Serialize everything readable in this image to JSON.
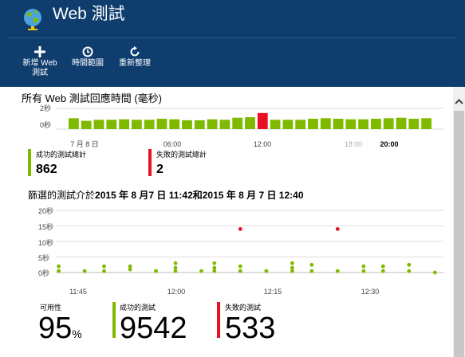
{
  "header": {
    "title": "Web 測試",
    "commands": [
      {
        "label_line1": "新增 Web",
        "label_line2": "測試"
      },
      {
        "label": "時間範圍"
      },
      {
        "label": "重新整理"
      }
    ]
  },
  "response_section": {
    "title": "所有 Web 測試回應時間 (毫秒)",
    "y_ticks": [
      "2秒",
      "0秒"
    ],
    "x_ticks": [
      {
        "label": "7 月 8 日",
        "style": "normal"
      },
      {
        "label": "06:00",
        "style": "normal"
      },
      {
        "label": "12:00",
        "style": "normal"
      },
      {
        "label": "18:00",
        "style": "dim"
      },
      {
        "label": "20:00",
        "style": "strong"
      }
    ]
  },
  "summary_stats": {
    "success_label": "成功的測試總計",
    "success_value": "862",
    "fail_label": "失敗的測試總計",
    "fail_value": "2"
  },
  "filter": {
    "prefix": "篩選的測試介於",
    "range": "2015 年 8 月7 日 11:42和2015 年 8 月 7 日 12:40"
  },
  "scatter_section": {
    "y_ticks": [
      "20秒",
      "15秒",
      "10秒",
      "5秒",
      "0秒"
    ],
    "x_ticks": [
      "11:45",
      "12:00",
      "12:15",
      "12:30"
    ]
  },
  "bottom_stats": {
    "availability_label": "可用性",
    "availability_value": "95",
    "availability_unit": "%",
    "success_label": "成功的測試",
    "success_value": "9542",
    "fail_label": "失敗的測試",
    "fail_value": "533"
  },
  "colors": {
    "header_bg": "#0e3d6e",
    "success": "#7fba00",
    "failure": "#e81123"
  },
  "chart_data": [
    {
      "type": "bar",
      "y_range_seconds": [
        0,
        2
      ],
      "series": [
        {
          "values": [
            1.05,
            0.8,
            0.9,
            0.9,
            0.95,
            0.9,
            0.9,
            1.0,
            0.95,
            0.85,
            0.85,
            0.95,
            0.9,
            1.1,
            1.15,
            1.55,
            0.9,
            0.9,
            0.9,
            1.0,
            1.05,
            1.0,
            0.95,
            0.95,
            1.0,
            1.05,
            1.1,
            1.0,
            1.05
          ],
          "status": [
            "ok",
            "ok",
            "ok",
            "ok",
            "ok",
            "ok",
            "ok",
            "ok",
            "ok",
            "ok",
            "ok",
            "ok",
            "ok",
            "ok",
            "ok",
            "fail",
            "ok",
            "ok",
            "ok",
            "ok",
            "ok",
            "ok",
            "ok",
            "ok",
            "ok",
            "ok",
            "ok",
            "ok",
            "ok"
          ]
        }
      ],
      "grid": true
    },
    {
      "type": "scatter",
      "y_range_seconds": [
        0,
        20
      ],
      "grid": true,
      "series": [
        {
          "status": "success",
          "points": [
            {
              "x": "11:42",
              "y": 0.5
            },
            {
              "x": "11:42",
              "y": 2.0
            },
            {
              "x": "11:46",
              "y": 0.5
            },
            {
              "x": "11:49",
              "y": 0.5
            },
            {
              "x": "11:49",
              "y": 2.0
            },
            {
              "x": "11:53",
              "y": 1.0
            },
            {
              "x": "11:53",
              "y": 2.0
            },
            {
              "x": "11:57",
              "y": 0.5
            },
            {
              "x": "12:00",
              "y": 0.5
            },
            {
              "x": "12:00",
              "y": 1.5
            },
            {
              "x": "12:00",
              "y": 3.0
            },
            {
              "x": "12:04",
              "y": 0.5
            },
            {
              "x": "12:06",
              "y": 0.5
            },
            {
              "x": "12:06",
              "y": 1.5
            },
            {
              "x": "12:06",
              "y": 3.0
            },
            {
              "x": "12:10",
              "y": 0.5
            },
            {
              "x": "12:10",
              "y": 2.0
            },
            {
              "x": "12:14",
              "y": 0.5
            },
            {
              "x": "12:18",
              "y": 0.5
            },
            {
              "x": "12:18",
              "y": 1.5
            },
            {
              "x": "12:18",
              "y": 3.0
            },
            {
              "x": "12:21",
              "y": 0.5
            },
            {
              "x": "12:21",
              "y": 2.5
            },
            {
              "x": "12:25",
              "y": 0.5
            },
            {
              "x": "12:29",
              "y": 0.5
            },
            {
              "x": "12:29",
              "y": 2.0
            },
            {
              "x": "12:32",
              "y": 0.5
            },
            {
              "x": "12:32",
              "y": 2.0
            },
            {
              "x": "12:36",
              "y": 0.5
            },
            {
              "x": "12:36",
              "y": 2.5
            },
            {
              "x": "12:40",
              "y": 0.0
            }
          ]
        },
        {
          "status": "failure",
          "points": [
            {
              "x": "12:10",
              "y": 14.0
            },
            {
              "x": "12:25",
              "y": 14.0
            }
          ]
        }
      ]
    }
  ]
}
